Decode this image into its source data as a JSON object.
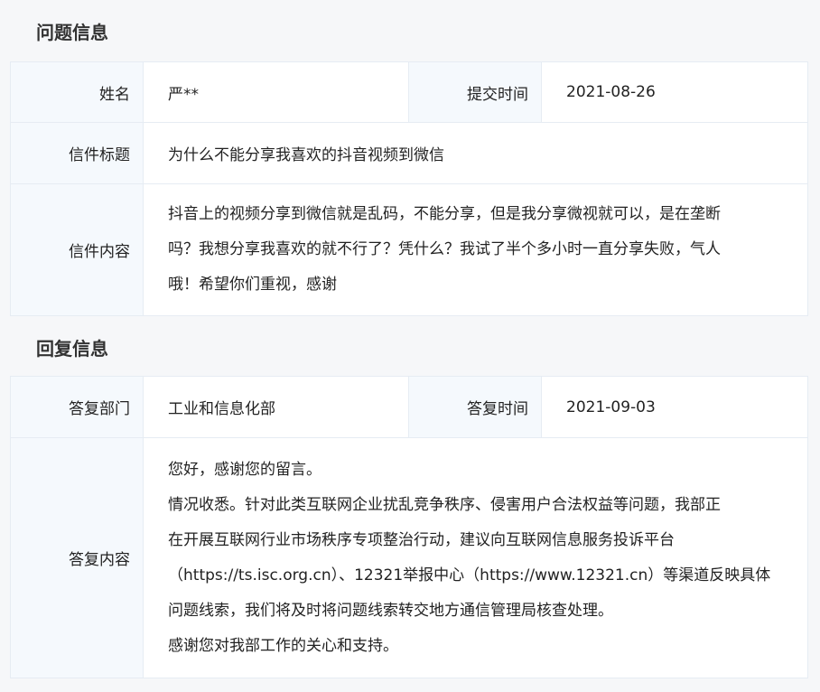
{
  "question_section": {
    "title": "问题信息",
    "name_label": "姓名",
    "name_value": "严**",
    "submit_time_label": "提交时间",
    "submit_time_value": "2021-08-26",
    "subject_label": "信件标题",
    "subject_value": "为什么不能分享我喜欢的抖音视频到微信",
    "content_label": "信件内容",
    "content_lines": [
      "抖音上的视频分享到微信就是乱码，不能分享，但是我分享微视就可以，是在垄断",
      "吗？我想分享我喜欢的就不行了？凭什么？我试了半个多小时一直分享失败，气人",
      "哦！希望你们重视，感谢"
    ]
  },
  "reply_section": {
    "title": "回复信息",
    "dept_label": "答复部门",
    "dept_value": "工业和信息化部",
    "reply_time_label": "答复时间",
    "reply_time_value": "2021-09-03",
    "content_label": "答复内容",
    "content_lines": [
      "您好，感谢您的留言。",
      "情况收悉。针对此类互联网企业扰乱竞争秩序、侵害用户合法权益等问题，我部正",
      "在开展互联网行业市场秩序专项整治行动，建议向互联网信息服务投诉平台",
      "（https://ts.isc.org.cn）、12321举报中心（https://www.12321.cn）等渠道反映具体",
      "问题线索，我们将及时将问题线索转交地方通信管理局核查处理。",
      "感谢您对我部工作的关心和支持。"
    ]
  }
}
